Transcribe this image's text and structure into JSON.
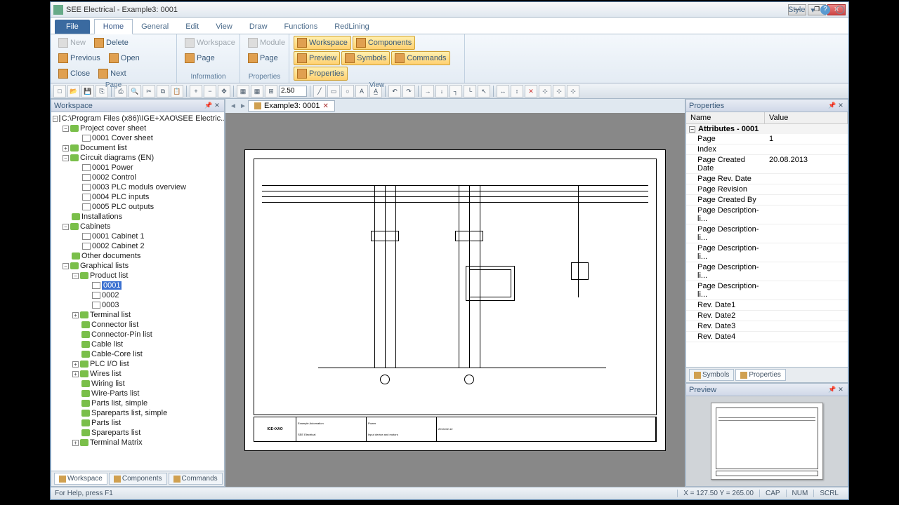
{
  "title": "SEE Electrical - Example3: 0001",
  "ribbon": {
    "file": "File",
    "tabs": [
      "Home",
      "General",
      "Edit",
      "View",
      "Draw",
      "Functions",
      "RedLining"
    ],
    "style": "Style",
    "groups": {
      "page": {
        "label": "Page",
        "new": "New",
        "open": "Open",
        "delete": "Delete",
        "close": "Close",
        "previous": "Previous",
        "next": "Next"
      },
      "info": {
        "label": "Information",
        "workspace": "Workspace",
        "page": "Page",
        "module": "Module",
        "page2": "Page"
      },
      "props": {
        "label": "Properties"
      },
      "view": {
        "label": "View",
        "workspace": "Workspace",
        "symbols": "Symbols",
        "components": "Components",
        "commands": "Commands",
        "preview": "Preview",
        "properties": "Properties"
      }
    }
  },
  "zoom": "2.50",
  "workspace": {
    "title": "Workspace",
    "root": "C:\\Program Files (x86)\\IGE+XAO\\SEE Electric...",
    "project_cover": "Project cover sheet",
    "cover_page": "0001 Cover sheet",
    "doc_list": "Document list",
    "circuit": "Circuit diagrams (EN)",
    "circuits": [
      "0001 Power",
      "0002 Control",
      "0003 PLC moduls overview",
      "0004 PLC inputs",
      "0005 PLC outputs"
    ],
    "installations": "Installations",
    "cabinets": "Cabinets",
    "cabinet_items": [
      "0001 Cabinet 1",
      "0002 Cabinet 2"
    ],
    "other": "Other documents",
    "graphical": "Graphical lists",
    "product_list": "Product list",
    "product_items": [
      "0001",
      "0002",
      "0003"
    ],
    "lists": [
      "Terminal list",
      "Connector list",
      "Connector-Pin list",
      "Cable list",
      "Cable-Core list",
      "PLC I/O list",
      "Wires list",
      "Wiring list",
      "Wire-Parts list",
      "Parts list, simple",
      "Spareparts list, simple",
      "Parts list",
      "Spareparts list",
      "Terminal Matrix"
    ]
  },
  "ws_tabs": [
    "Workspace",
    "Components",
    "Commands"
  ],
  "doc_tab": "Example3: 0001",
  "titleblock": {
    "logo": "IGE+XAO",
    "company": "Example Automation",
    "sw": "SEE Electrical",
    "desc1": "Power",
    "desc2": "Input device and motors",
    "date": "2013-02-12"
  },
  "properties": {
    "title": "Properties",
    "cols": {
      "name": "Name",
      "value": "Value"
    },
    "cat": "Attributes - 0001",
    "rows": [
      {
        "n": "Page",
        "v": "1"
      },
      {
        "n": "Index",
        "v": ""
      },
      {
        "n": "Page Created Date",
        "v": "20.08.2013"
      },
      {
        "n": "Page Rev. Date",
        "v": ""
      },
      {
        "n": "Page Revision",
        "v": ""
      },
      {
        "n": "Page Created By",
        "v": ""
      },
      {
        "n": "Page Description-li...",
        "v": ""
      },
      {
        "n": "Page Description-li...",
        "v": ""
      },
      {
        "n": "Page Description-li...",
        "v": ""
      },
      {
        "n": "Page Description-li...",
        "v": ""
      },
      {
        "n": "Page Description-li...",
        "v": ""
      },
      {
        "n": "Rev. Date1",
        "v": ""
      },
      {
        "n": "Rev. Date2",
        "v": ""
      },
      {
        "n": "Rev. Date3",
        "v": ""
      },
      {
        "n": "Rev. Date4",
        "v": ""
      }
    ]
  },
  "prop_tabs": [
    "Symbols",
    "Properties"
  ],
  "preview": {
    "title": "Preview"
  },
  "status": {
    "help": "For Help, press F1",
    "coords": "X = 127.50  Y = 265.00",
    "cap": "CAP",
    "num": "NUM",
    "scrl": "SCRL"
  }
}
